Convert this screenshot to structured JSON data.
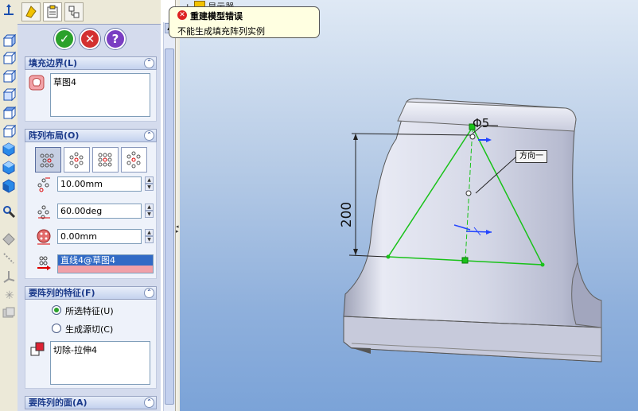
{
  "tooltip": {
    "title": "重建模型错误",
    "message": "不能生成填充阵列实例"
  },
  "tree": {
    "node_label": "显示器"
  },
  "property_manager": {
    "ok": "✓",
    "cancel": "✕",
    "help": "?",
    "fill_boundary": {
      "title": "填充边界(L)",
      "items": [
        "草图4"
      ]
    },
    "pattern_layout": {
      "title": "阵列布局(O)",
      "spacing": "10.00mm",
      "angle": "60.00deg",
      "margin": "0.00mm",
      "direction": "直线4@草图4"
    },
    "features": {
      "title": "要阵列的特征(F)",
      "options": [
        "所选特征(U)",
        "生成源切(C)"
      ],
      "selected_index": 0,
      "items": [
        "切除-拉伸4"
      ]
    },
    "faces": {
      "title": "要阵列的面(A)"
    }
  },
  "viewport": {
    "dimension_vertical": "200",
    "dimension_diameter": "Φ5",
    "direction_callout": "方向一"
  },
  "colors": {
    "sketch_green": "#19c219",
    "accent_blue": "#1b3a8a",
    "error_red": "#dd2222"
  }
}
